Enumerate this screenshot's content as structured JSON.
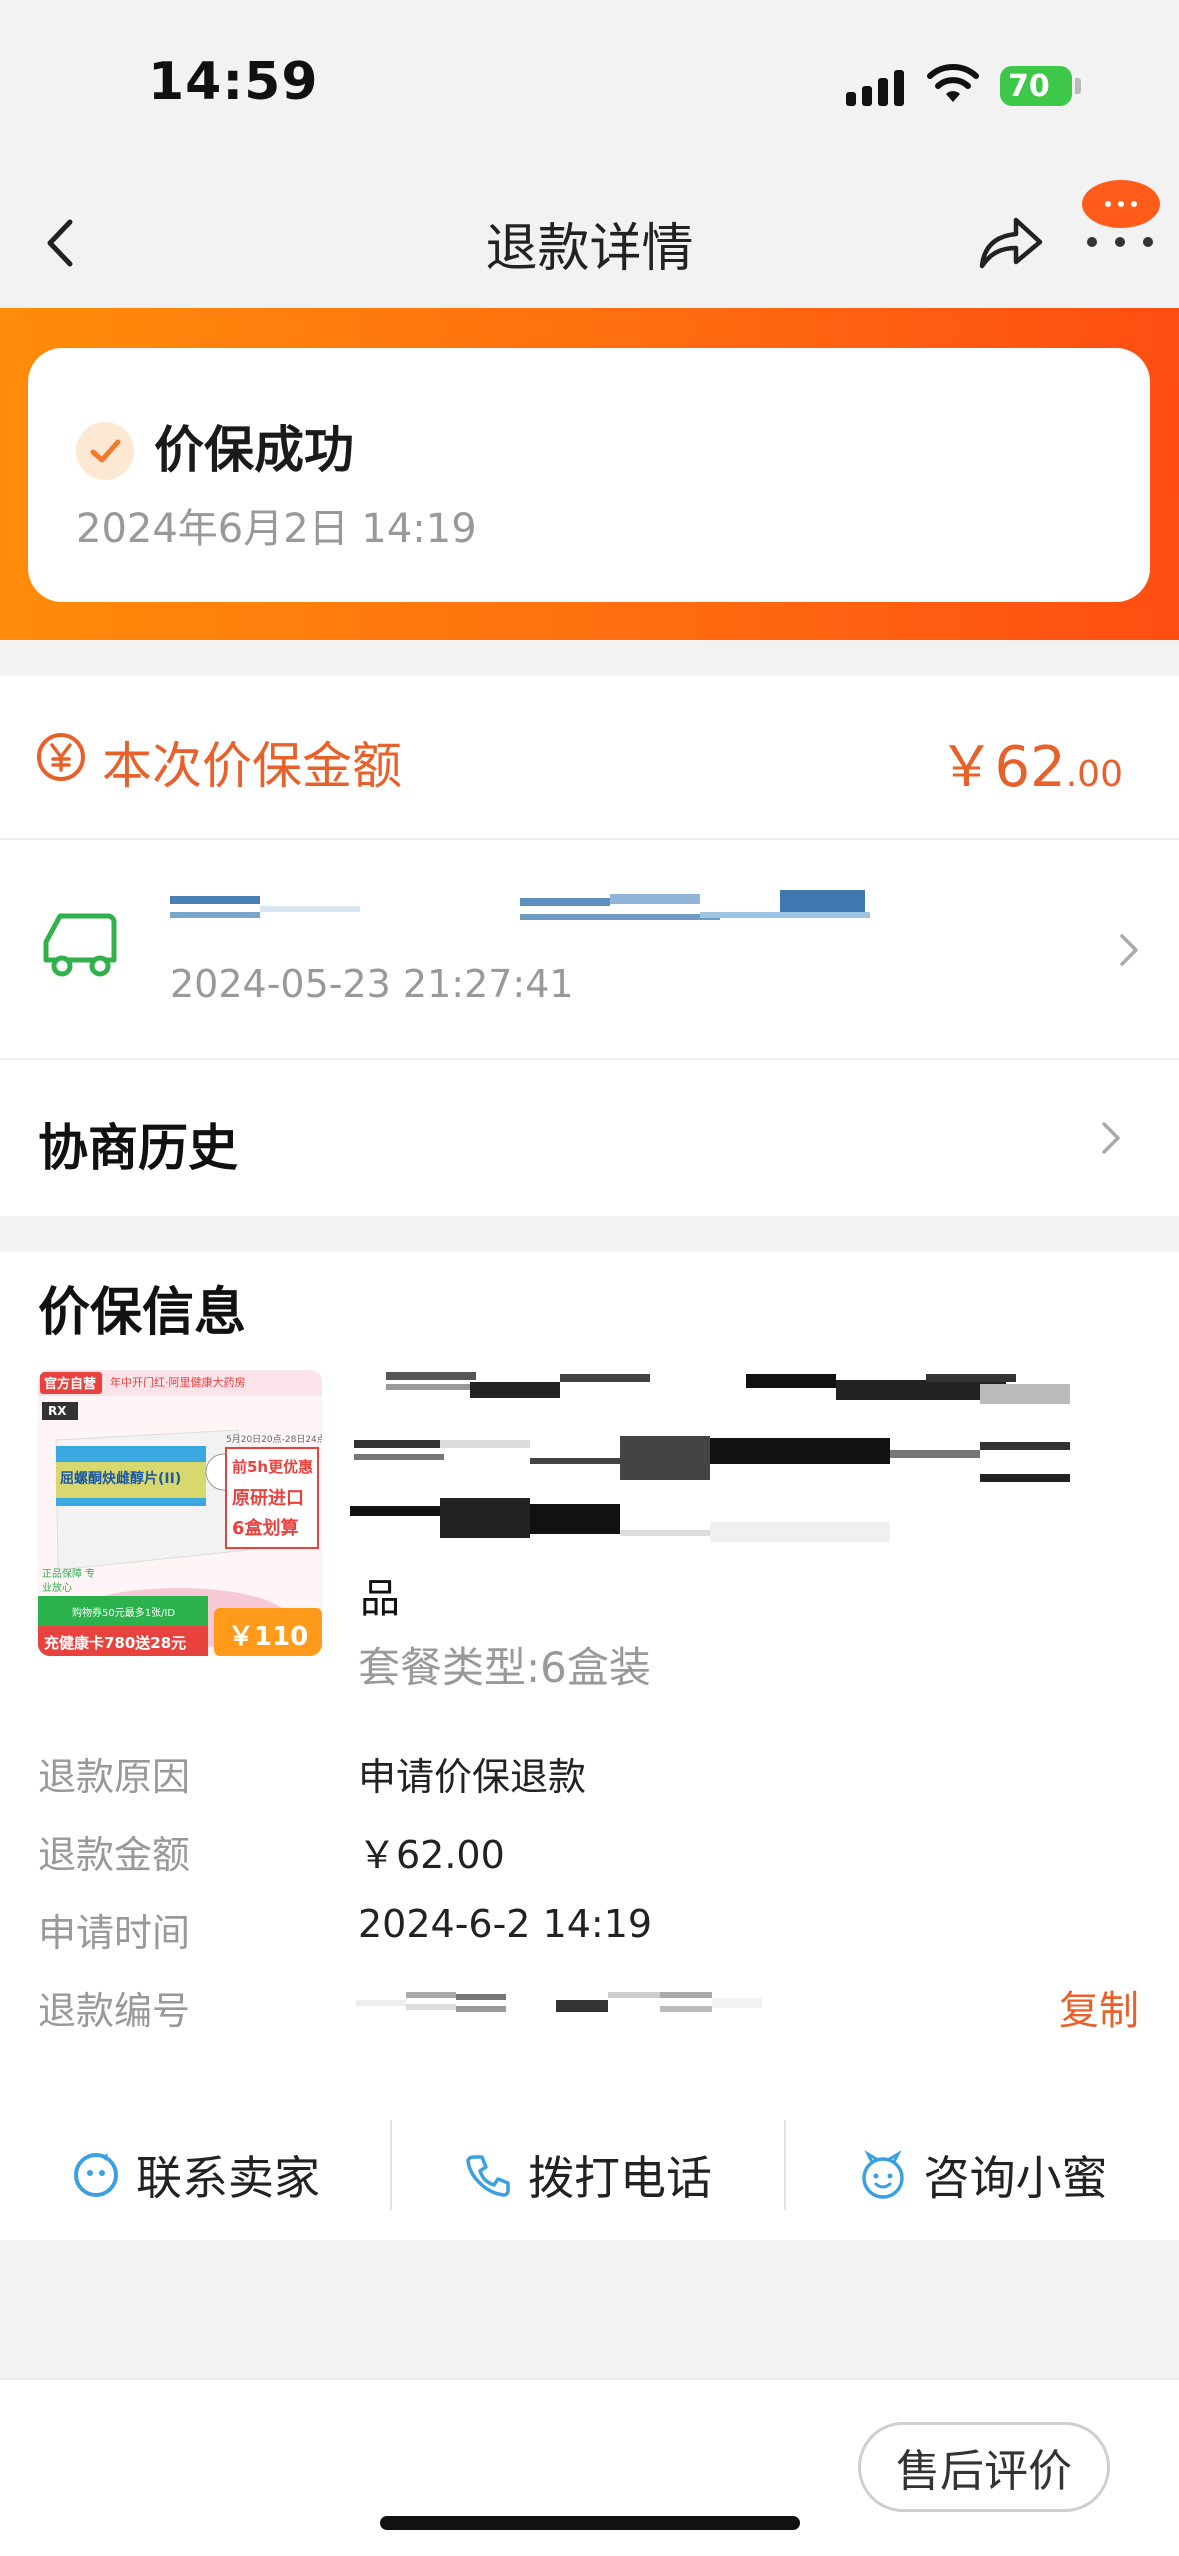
{
  "status_bar": {
    "time": "14:59",
    "battery": "70"
  },
  "header": {
    "title": "退款详情"
  },
  "refund_status": {
    "title": "价保成功",
    "time": "2024年6月2日 14:19"
  },
  "price_protect": {
    "label": "本次价保金额",
    "currency": "￥",
    "amount_int": "62",
    "amount_dec": ".00"
  },
  "logistics": {
    "time": "2024-05-23 21:27:41"
  },
  "history": {
    "label": "协商历史"
  },
  "info": {
    "title": "价保信息",
    "product_suffix": "品",
    "spec": "套餐类型:6盒装",
    "rows": [
      {
        "label": "退款原因",
        "value": "申请价保退款"
      },
      {
        "label": "退款金额",
        "value": "￥62.00"
      },
      {
        "label": "申请时间",
        "value": "2024-6-2 14:19"
      },
      {
        "label": "退款编号",
        "value": ""
      }
    ],
    "copy_label": "复制"
  },
  "product_image": {
    "top_badge": "官方自营",
    "top_text": "年中开门红·阿里健康大药房",
    "rx": "RX",
    "product_name": "屈螺酮炔雌醇片(II)",
    "promo_date": "5月20日20点-28日24点",
    "promo1": "前5h更优惠",
    "promo2": "原研进口",
    "promo3": "6盒划算",
    "store_badge": "正品保障 专业放心",
    "coupon": "购物券50元最多1张/ID",
    "card": "充健康卡780送28元",
    "price": "￥110"
  },
  "actions": [
    {
      "label": "联系卖家",
      "icon": "chat-icon"
    },
    {
      "label": "拨打电话",
      "icon": "phone-icon"
    },
    {
      "label": "咨询小蜜",
      "icon": "assistant-icon"
    }
  ],
  "bottom": {
    "review_label": "售后评价"
  },
  "colors": {
    "accent": "#e8612b",
    "banner_start": "#ff8c0a",
    "banner_end": "#ff4d12"
  }
}
